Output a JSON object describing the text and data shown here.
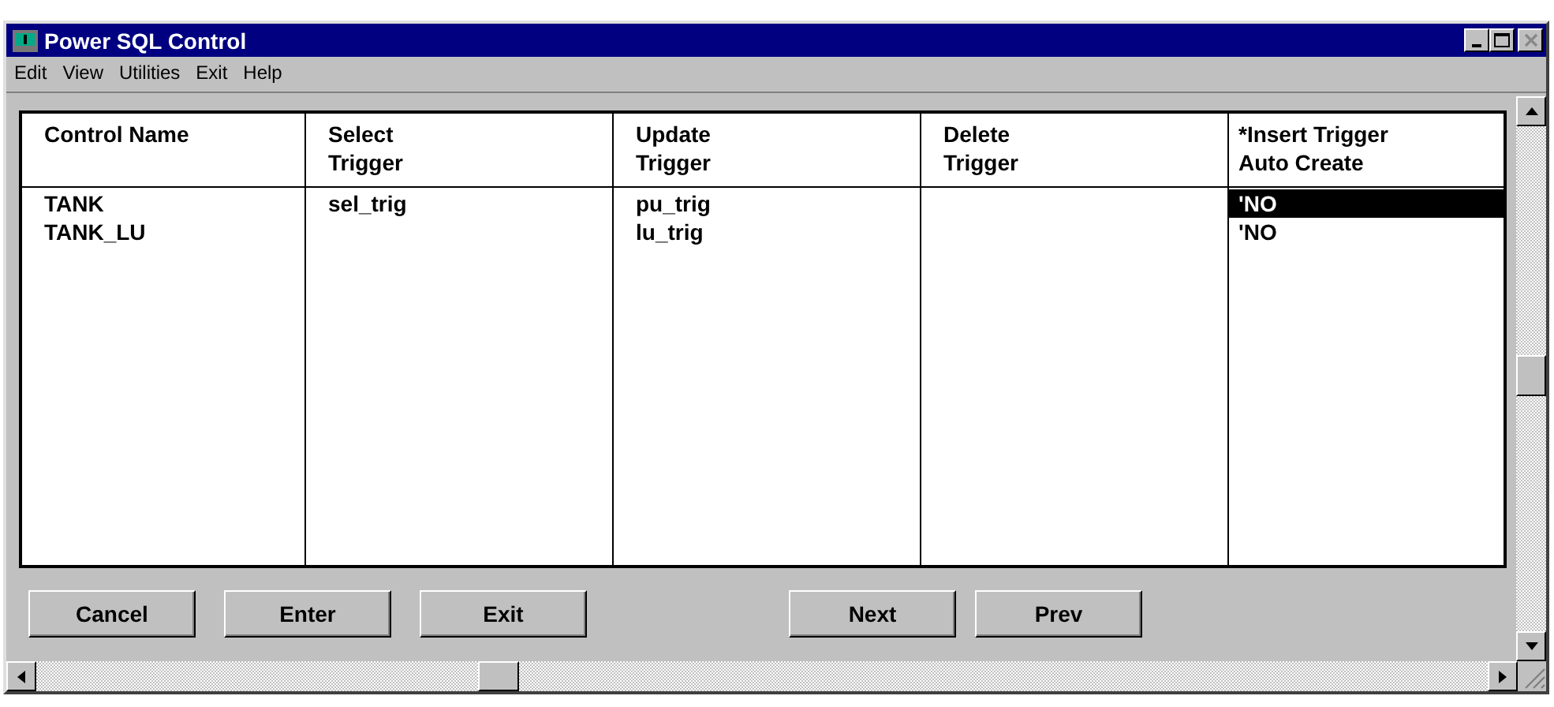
{
  "window": {
    "title": "Power SQL Control"
  },
  "menu": [
    "Edit",
    "View",
    "Utilities",
    "Exit",
    "Help"
  ],
  "table": {
    "columns": [
      "Control Name",
      "Select\nTrigger",
      "Update\nTrigger",
      "Delete\nTrigger",
      "*Insert Trigger\nAuto Create"
    ],
    "rows": [
      {
        "control_name": "TANK",
        "select_trigger": "sel_trig",
        "update_trigger": "pu_trig",
        "auto_create": {
          "value": "'NO",
          "selected": true
        }
      },
      {
        "control_name": "TANK_LU",
        "update_trigger": "lu_trig",
        "auto_create": {
          "value": "'NO",
          "selected": false
        }
      }
    ]
  },
  "buttons": [
    "Cancel",
    "Enter",
    "Exit",
    "Next",
    "Prev"
  ]
}
